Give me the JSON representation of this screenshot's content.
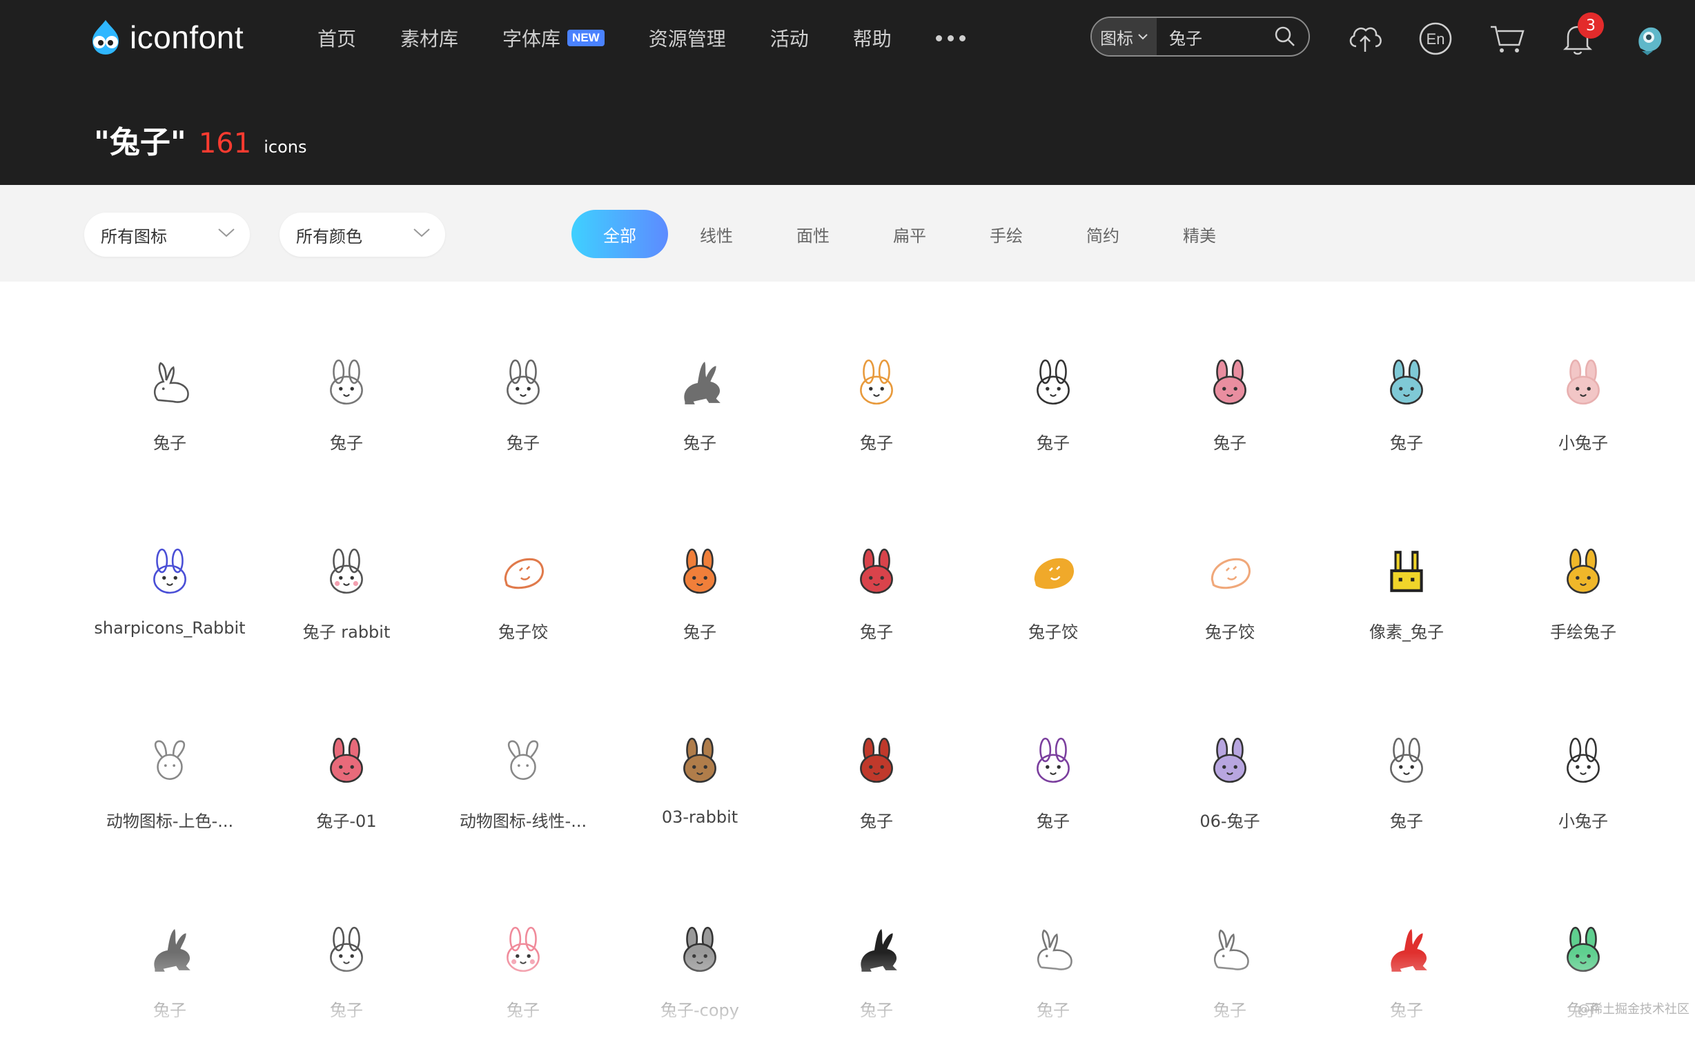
{
  "header": {
    "logo_text": "iconfont",
    "nav": [
      {
        "label": "首页"
      },
      {
        "label": "素材库"
      },
      {
        "label": "字体库",
        "badge": "NEW"
      },
      {
        "label": "资源管理"
      },
      {
        "label": "活动"
      },
      {
        "label": "帮助"
      }
    ],
    "search": {
      "type_label": "图标",
      "query": "兔子"
    },
    "notifications": "3"
  },
  "result": {
    "query": "\"兔子\"",
    "count": "161",
    "unit": "icons"
  },
  "filters": {
    "type_select": "所有图标",
    "color_select": "所有颜色",
    "tabs": [
      "全部",
      "线性",
      "面性",
      "扁平",
      "手绘",
      "简约",
      "精美"
    ],
    "active_tab": "全部"
  },
  "icons": [
    [
      {
        "name": "兔子",
        "icon": "rabbit-line-icon",
        "color": "#555555"
      },
      {
        "name": "兔子",
        "icon": "rabbit-cartoon-icon",
        "color": "#777777"
      },
      {
        "name": "兔子",
        "icon": "rabbit-head-line-icon",
        "color": "#666666"
      },
      {
        "name": "兔子",
        "icon": "rabbit-silhouette-icon",
        "color": "#6e6e6e"
      },
      {
        "name": "兔子",
        "icon": "rabbit-carrot-icon",
        "color": "#e89a3c"
      },
      {
        "name": "兔子",
        "icon": "rabbit-head-line-icon",
        "color": "#333333"
      },
      {
        "name": "兔子",
        "icon": "rabbit-pink-face-icon",
        "color": "#e98ea0"
      },
      {
        "name": "兔子",
        "icon": "rabbit-blue-face-icon",
        "color": "#7fc9d6"
      },
      {
        "name": "小兔子",
        "icon": "rabbit-white-face-icon",
        "color": "#f2c6c6"
      }
    ],
    [
      {
        "name": "sharpicons_Rabbit",
        "icon": "rabbit-blue-line-icon",
        "color": "#4a4fd6"
      },
      {
        "name": "兔子 rabbit",
        "icon": "rabbit-blush-icon",
        "color": "#555555"
      },
      {
        "name": "兔子饺",
        "icon": "dumpling-icon",
        "color": "#e07a4b"
      },
      {
        "name": "兔子",
        "icon": "rabbit-orange-icon",
        "color": "#f07f3a"
      },
      {
        "name": "兔子",
        "icon": "rabbit-red-face-icon",
        "color": "#d9434b"
      },
      {
        "name": "兔子饺",
        "icon": "dumpling-filled-icon",
        "color": "#f0a92a"
      },
      {
        "name": "兔子饺",
        "icon": "dumpling-line-icon",
        "color": "#f0a87a"
      },
      {
        "name": "像素_兔子",
        "icon": "rabbit-pixel-icon",
        "color": "#f0d52a"
      },
      {
        "name": "手绘兔子",
        "icon": "rabbit-handdrawn-icon",
        "color": "#f0b72a"
      }
    ],
    [
      {
        "name": "动物图标-上色-...",
        "icon": "rabbit-outline-icon",
        "color": "#888888"
      },
      {
        "name": "兔子-01",
        "icon": "rabbit-pink-icon",
        "color": "#e86a7a"
      },
      {
        "name": "动物图标-线性-...",
        "icon": "rabbit-outline-icon",
        "color": "#888888"
      },
      {
        "name": "03-rabbit",
        "icon": "rabbit-brown-icon",
        "color": "#b07d4a"
      },
      {
        "name": "兔子",
        "icon": "rabbit-small-red-icon",
        "color": "#c0392b"
      },
      {
        "name": "兔子",
        "icon": "rabbit-purple-line-icon",
        "color": "#7b3f9e"
      },
      {
        "name": "06-兔子",
        "icon": "rabbit-lilac-face-icon",
        "color": "#b8a6e0"
      },
      {
        "name": "兔子",
        "icon": "rabbit-round-face-icon",
        "color": "#666666"
      },
      {
        "name": "小兔子",
        "icon": "rabbit-sitting-icon",
        "color": "#333333"
      }
    ],
    [
      {
        "name": "兔子",
        "icon": "rabbit-silhouette-icon",
        "color": "#6e6e6e"
      },
      {
        "name": "兔子",
        "icon": "rabbit-whiskers-icon",
        "color": "#555555"
      },
      {
        "name": "兔子",
        "icon": "rabbit-blush-face-icon",
        "color": "#f08a9a"
      },
      {
        "name": "兔子-copy",
        "icon": "rabbit-gray-head-icon",
        "color": "#9a9a9a"
      },
      {
        "name": "兔子",
        "icon": "rabbit-silhouette-icon",
        "color": "#222222"
      },
      {
        "name": "兔子",
        "icon": "rabbit-line-icon",
        "color": "#777777"
      },
      {
        "name": "兔子",
        "icon": "rabbit-line-icon",
        "color": "#777777"
      },
      {
        "name": "兔子",
        "icon": "rabbit-silhouette-icon",
        "color": "#e0302e"
      },
      {
        "name": "兔子",
        "icon": "rabbit-green-head-icon",
        "color": "#5fcf8f"
      }
    ]
  ],
  "watermark": "@稀土掘金技术社区"
}
